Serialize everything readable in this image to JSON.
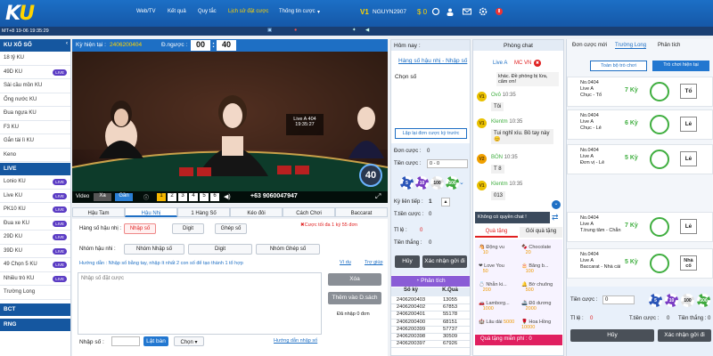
{
  "header": {
    "logo_k": "K",
    "logo_u": "U",
    "nav": [
      "Web/TV",
      "Kết quả",
      "Quy tắc",
      "Lịch sử đặt cược",
      "Thống tin cược"
    ],
    "thong_tin_caret": "▾",
    "vip": "V1",
    "username": "NGUYN2907",
    "balance": "$ 0",
    "sub_time": "MT+8 19-06 19:35:29"
  },
  "sidebar": {
    "section1": "KU XỔ SỐ",
    "items1": [
      {
        "label": "18 tỷ KU"
      },
      {
        "label": "49D KU",
        "badge": "LIVE"
      },
      {
        "label": "Sài cầu mồn KU"
      },
      {
        "label": "Ống nước KU"
      },
      {
        "label": "Đua ngựa KU"
      },
      {
        "label": "F3 KU"
      },
      {
        "label": "Gắn tài lì KU"
      },
      {
        "label": "Keno"
      }
    ],
    "section2": "LIVE",
    "items2": [
      {
        "label": "Lonio KU",
        "badge": "LIVE"
      },
      {
        "label": "Live KU",
        "badge": "LIVE"
      },
      {
        "label": "PK10 KU",
        "badge": "LIVE"
      },
      {
        "label": "Đua xe KU",
        "badge": "LIVE"
      },
      {
        "label": "29D KU",
        "badge": "LIVE"
      },
      {
        "label": "39D KU",
        "badge": "LIVE"
      },
      {
        "label": "49 Chọn 5 KU",
        "badge": "LIVE"
      },
      {
        "label": "Nhiều trò KU",
        "badge": "LIVE"
      },
      {
        "label": "Trường Long"
      }
    ],
    "section3": "BCT",
    "section4": "RNG"
  },
  "game": {
    "ky_label": "Kỳ hiện tại :",
    "ky_value": "2406200404",
    "countdown_label": "Đ.ngược :",
    "mm": "00",
    "ss": "40",
    "timer_big": "40",
    "live_label": "Live A",
    "live_count": "404",
    "video_time": "19:35:27",
    "phone": "+63 9060047947",
    "video_word": "Video",
    "xa": "Xa",
    "gan": "Gần",
    "cams": [
      "1",
      "2",
      "3",
      "4",
      "5",
      "6"
    ]
  },
  "bet_tabs": [
    "Hậu Tam",
    "Hậu Nhị",
    "1 Hàng Số",
    "Kéo đôi",
    "Cách Chơi",
    "Baccarat"
  ],
  "bet": {
    "hang_so": "Hàng số hậu nhị :",
    "nhap_so": "Nhập số",
    "digit": "Digit",
    "ghep_so": "Ghép số",
    "warning": "✖Cược tối đa 1 ký 55 đơn",
    "nhom_label": "Nhóm hậu nhi :",
    "nhom_nhap": "Nhóm Nhập số",
    "nhom_digit": "Digit",
    "nhom_ghep": "Nhóm Ghép số",
    "huong_dan": "Hướng dẫn : Nhập số bằng tay, nhập ít nhất 2 con số để tạo thành 1 tổ hợp",
    "vi_du": "Ví dụ",
    "tro_giup": "Trợ giúp",
    "placeholder": "Nhập số đặt cược",
    "xoa": "Xóa",
    "them_vao": "Thêm vào D.sách",
    "da_nhap": "Đã nhập 0 đơn",
    "nhap_so_label": "Nhập số :",
    "lat_ban": "Lật bàn",
    "chon": "Chọn",
    "huong_dan_nhap": "Hướng dẫn nhập số"
  },
  "order": {
    "hom_nay": "Hôm nay :",
    "title": "Hàng số hậu nhị - Nhập số",
    "chon_so": "Chọn số",
    "lap_lai": "Lặp lại đơn cược kỳ trước",
    "don_cuoc": "Đơn cược :",
    "don_val": "0",
    "tien_cuoc": "Tiền cược :",
    "tien_val": "0 - 0",
    "chips": [
      "5",
      "10",
      "100",
      "500"
    ],
    "ky_tiep": "Kỳ liên tiếp :",
    "ky_val": "1",
    "t_tien": "T.tiền cược :",
    "t_val": "0",
    "ti_le": "Tỉ lệ :",
    "ti_val": "0",
    "tien_thang": "Tiền thắng :",
    "thang_val": "0",
    "huy": "Hủy",
    "xac_nhan": "Xác nhận gởi đi",
    "phan_tich": "Phân tích",
    "col_ky": "Số kỳ",
    "col_kq": "K.Quả",
    "rows": [
      [
        "2406200403",
        "13055"
      ],
      [
        "2406200402",
        "67853"
      ],
      [
        "2406200401",
        "55178"
      ],
      [
        "2406200400",
        "68151"
      ],
      [
        "2406200399",
        "57737"
      ],
      [
        "2406200398",
        "30509"
      ],
      [
        "2406200397",
        "67926"
      ]
    ]
  },
  "chat": {
    "title": "Phòng chat",
    "room": "Live A",
    "mc": "MC VN",
    "close": "✖",
    "lead": "khác. Đề phòng bị lừa, cẩm ơn!",
    "messages": [
      {
        "avatar": "V1",
        "name": "Ovỏ",
        "time": "10:35",
        "text": "Tôi"
      },
      {
        "avatar": "V1",
        "name": "Klentm",
        "time": "10:35",
        "text": "Tui nghỉ xíu. Bồ tay này"
      },
      {
        "avatar": "V2",
        "name": "BÒN",
        "time": "10:35",
        "text": "T 8"
      },
      {
        "avatar": "V1",
        "name": "Klentm",
        "time": "10:35",
        "text": "013"
      }
    ],
    "no_perm": "Không có quyền chat !",
    "qua_tang": "Quà tặng",
    "goi_qua": "Gói quà tặng",
    "gifts": [
      "Động vu",
      "Chocolate",
      "Love You",
      "Băng b...",
      "Nhẫn ki...",
      "Bờ chuông",
      "Lamborg...",
      "Đũ dương",
      "Lâu dài",
      "Hoa Hồng"
    ],
    "gift_vals": [
      "10",
      "20",
      "50",
      "100",
      "200",
      "500",
      "1000",
      "2000",
      "5000",
      "10000"
    ],
    "qua_mien_phi": "Quà tặng miễn phí :",
    "qua_val": "0"
  },
  "right": {
    "tabs": [
      "Đơn cược mới",
      "Trường Long",
      "Phân tích"
    ],
    "toan_bo": "Toàn bộ trò chơi",
    "tro_choi": "Trò chơi hiện tại",
    "orders": [
      {
        "no": "No.0404",
        "game": "Live A",
        "type": "Chục - Tổ",
        "ky": "7 Kỳ",
        "pick": "Tổ"
      },
      {
        "no": "No.0404",
        "game": "Live A",
        "type": "Chục - Lẻ",
        "ky": "6 Kỳ",
        "pick": "Lẻ"
      },
      {
        "no": "No.0404",
        "game": "Live A",
        "type": "Đơn vị - Lẻ",
        "ky": "5 Kỳ",
        "pick": "Lẻ"
      },
      {
        "no": "No.0404",
        "game": "Live A",
        "type": "T.trung tâm - Chẵn",
        "ky": "7 Kỳ",
        "pick": "Lẻ"
      },
      {
        "no": "No.0404",
        "game": "Live A",
        "type": "Baccarat - Nhà cái",
        "ky": "5 Kỳ",
        "pick": "Nhà cố"
      }
    ],
    "tien_cuoc": "Tiền cược :",
    "tien_val": "0",
    "ti_le": "Tỉ lệ :",
    "tl_val": "0",
    "t_tien": "T.tiền cược :",
    "tt_val": "0",
    "tien_thang": "Tiền thắng :",
    "th_val": "0",
    "huy": "Hủy",
    "xac_nhan": "Xác nhận gởi đi"
  },
  "colors": {
    "primary": "#1e6fc4",
    "gold": "#ffd400",
    "green": "#3fae3f",
    "red": "#e02020"
  }
}
